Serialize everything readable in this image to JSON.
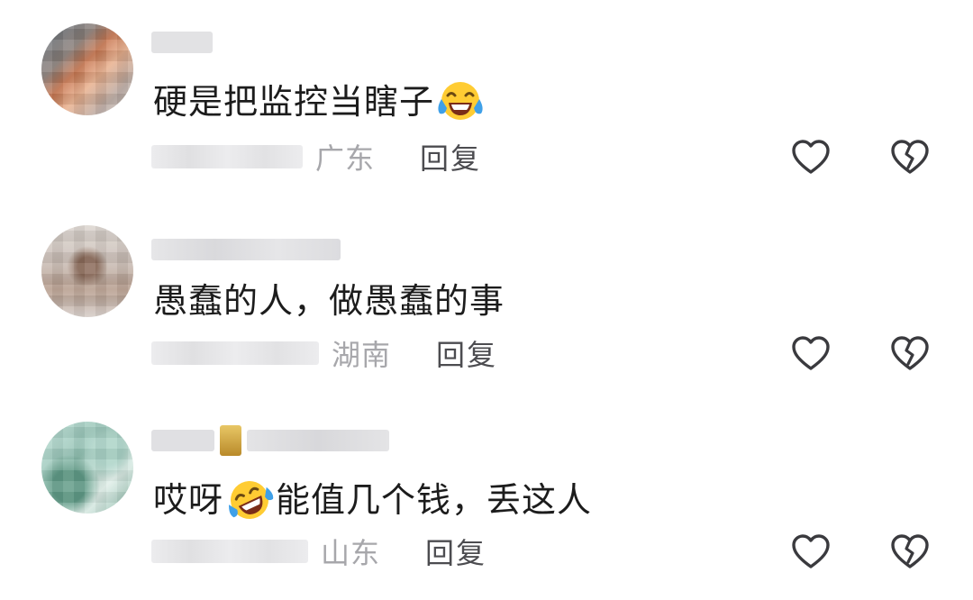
{
  "comments": [
    {
      "text_before": "硬是把监控当瞎子",
      "text_after": "",
      "emoji": "laughing-tears-emoji",
      "emoji_position": "end",
      "region": "广东",
      "reply_label": "回复",
      "like_icon": "heart-outline-icon",
      "dislike_icon": "broken-heart-icon"
    },
    {
      "text_before": "愚蠢的人，做愚蠢的事",
      "text_after": "",
      "emoji": "",
      "emoji_position": "none",
      "region": "湖南",
      "reply_label": "回复",
      "like_icon": "heart-outline-icon",
      "dislike_icon": "broken-heart-icon"
    },
    {
      "text_before": "哎呀",
      "text_after": "能值几个钱，丢这人",
      "emoji": "rolling-laughing-emoji",
      "emoji_position": "middle",
      "region": "山东",
      "reply_label": "回复",
      "like_icon": "heart-outline-icon",
      "dislike_icon": "broken-heart-icon"
    }
  ],
  "colors": {
    "text": "#1c1c1c",
    "region": "#a7a7ab",
    "reply": "#4c4c50",
    "icon_stroke": "#3a3a3e",
    "emoji_face": "#ffcc33",
    "emoji_tear": "#3fa0e8"
  }
}
